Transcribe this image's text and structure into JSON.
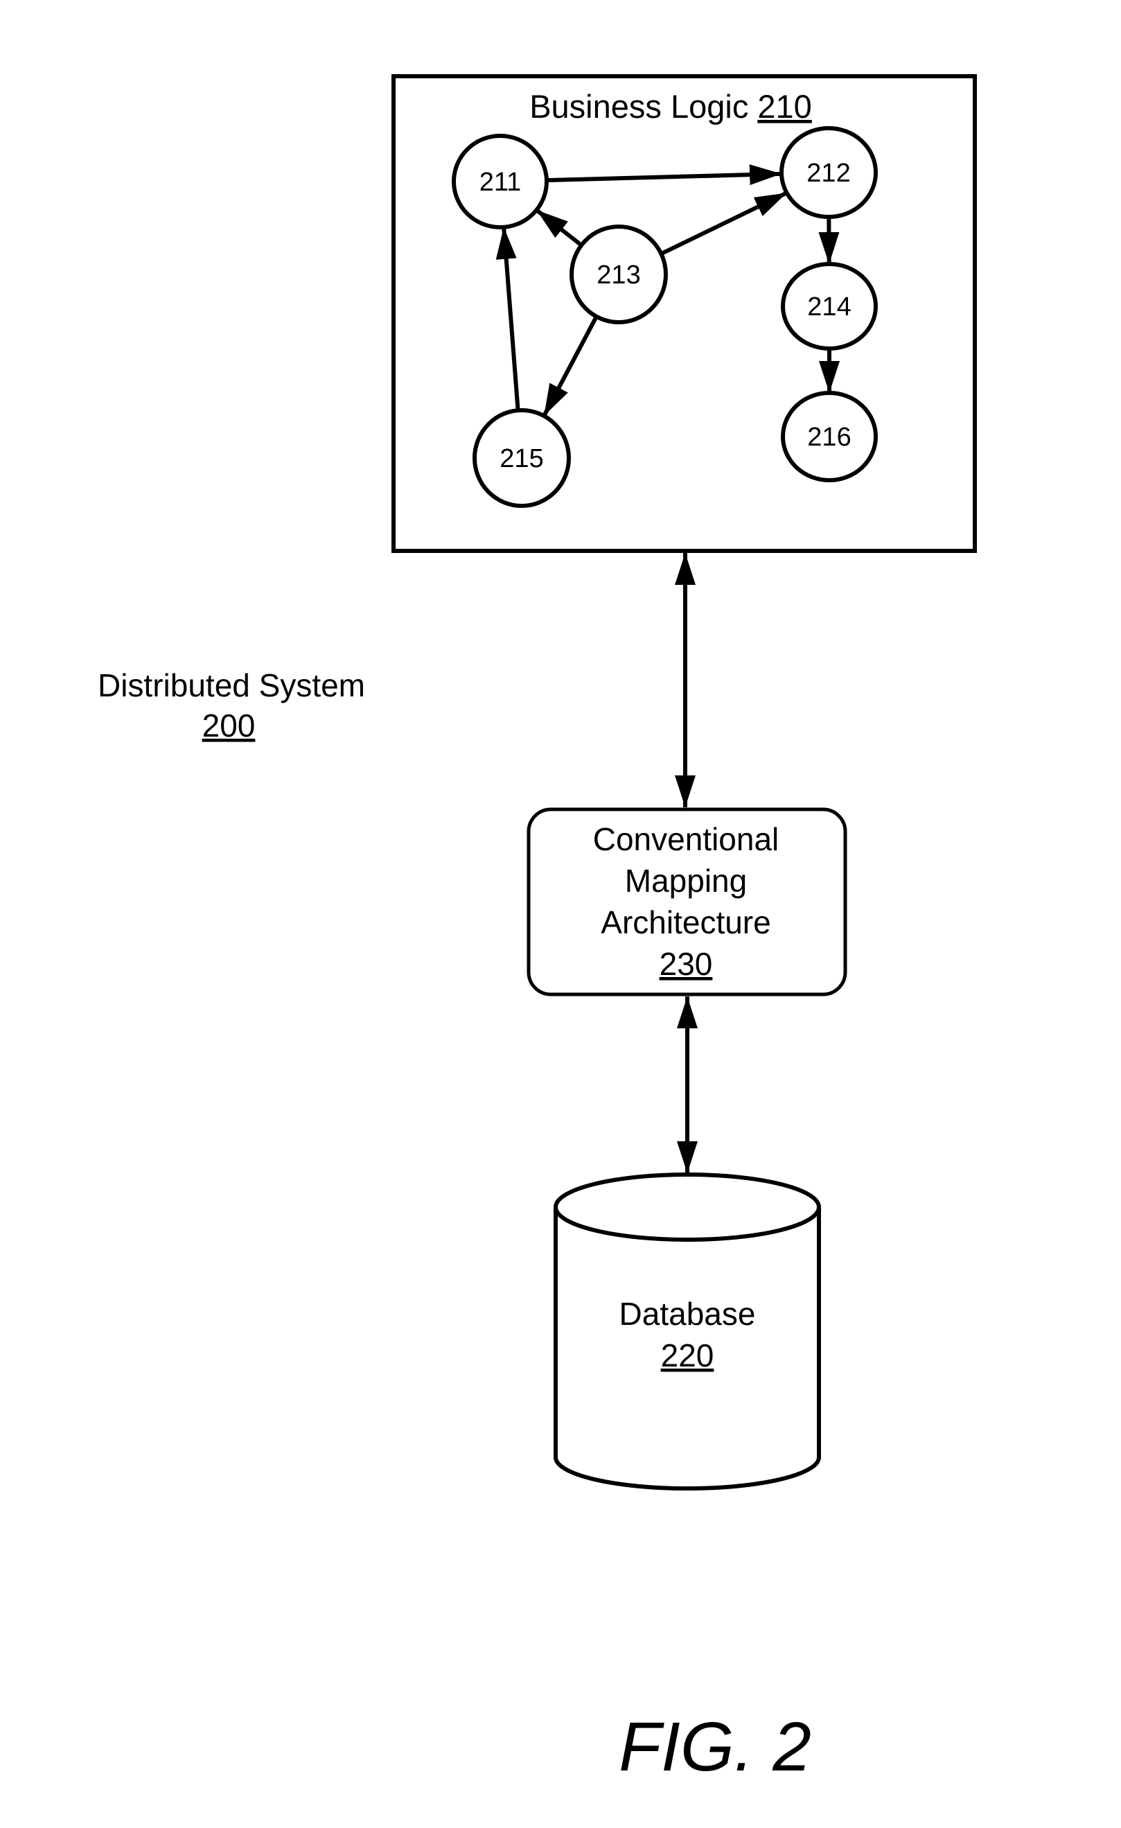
{
  "figure_label": "FIG. 2",
  "system": {
    "label": "Distributed System",
    "ref": "200"
  },
  "business_logic": {
    "label": "Business Logic",
    "ref": "210",
    "nodes": [
      {
        "id": "211",
        "label": "211"
      },
      {
        "id": "212",
        "label": "212"
      },
      {
        "id": "213",
        "label": "213"
      },
      {
        "id": "214",
        "label": "214"
      },
      {
        "id": "215",
        "label": "215"
      },
      {
        "id": "216",
        "label": "216"
      }
    ],
    "edges": [
      {
        "from": "211",
        "to": "212"
      },
      {
        "from": "213",
        "to": "211"
      },
      {
        "from": "213",
        "to": "212"
      },
      {
        "from": "213",
        "to": "215"
      },
      {
        "from": "215",
        "to": "211"
      },
      {
        "from": "212",
        "to": "214"
      },
      {
        "from": "214",
        "to": "216"
      }
    ]
  },
  "mapping": {
    "lines": [
      "Conventional",
      "Mapping",
      "Architecture"
    ],
    "ref": "230"
  },
  "database": {
    "label": "Database",
    "ref": "220"
  },
  "connections": [
    {
      "from": "210",
      "to": "230",
      "direction": "bidirectional"
    },
    {
      "from": "230",
      "to": "220",
      "direction": "bidirectional"
    }
  ]
}
